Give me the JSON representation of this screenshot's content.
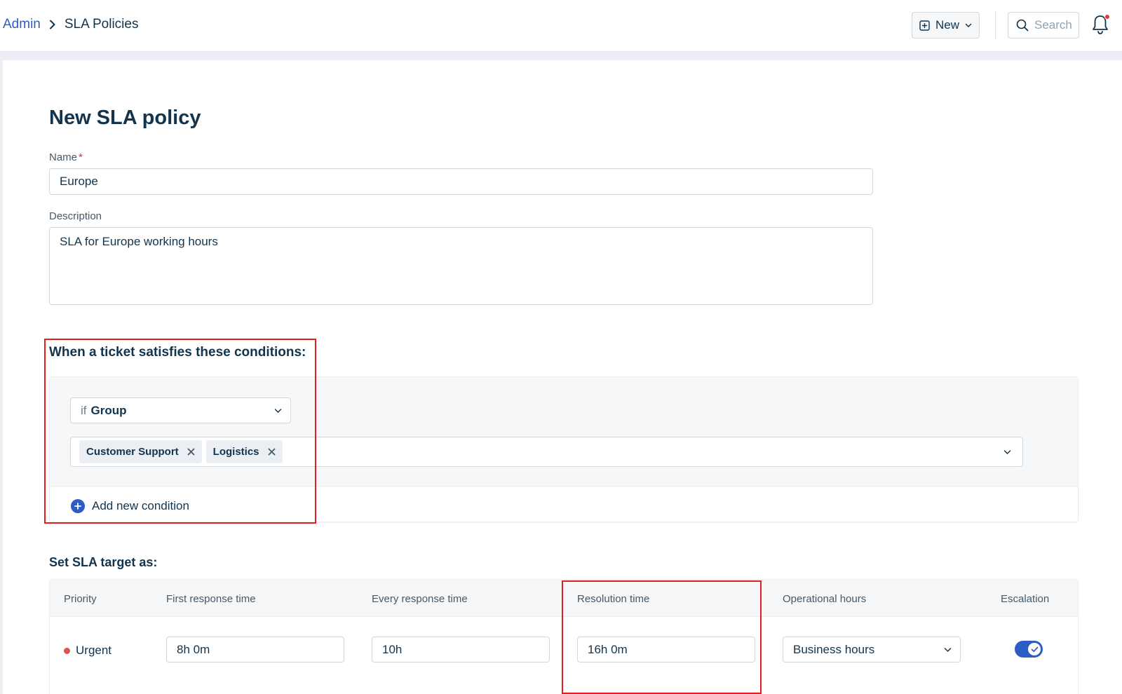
{
  "header": {
    "breadcrumb": {
      "parent": "Admin",
      "current": "SLA Policies"
    },
    "new_button": "New",
    "search_placeholder": "Search"
  },
  "form": {
    "title": "New SLA policy",
    "name_label": "Name",
    "name_value": "Europe",
    "description_label": "Description",
    "description_value": "SLA for Europe working hours"
  },
  "conditions": {
    "heading": "When a ticket satisfies these conditions:",
    "field_prefix": "if",
    "field_value": "Group",
    "selected_values": [
      "Customer Support",
      "Logistics"
    ],
    "add_condition_label": "Add new condition"
  },
  "sla_targets": {
    "heading": "Set SLA target as:",
    "columns": [
      "Priority",
      "First response time",
      "Every response time",
      "Resolution time",
      "Operational hours",
      "Escalation"
    ],
    "rows": [
      {
        "priority": "Urgent",
        "priority_color": "#e4504b",
        "first_response": "8h 0m",
        "every_response": "10h",
        "resolution": "16h 0m",
        "operational_hours": "Business hours",
        "escalation_enabled": true
      }
    ]
  },
  "colors": {
    "accent": "#2c5cc5",
    "highlight": "#e21e1e",
    "text": "#12344d"
  }
}
